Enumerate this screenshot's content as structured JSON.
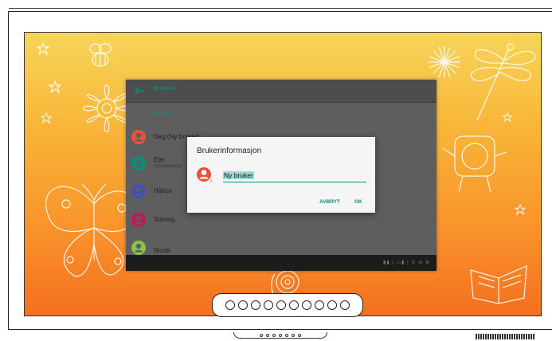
{
  "app_bar": {
    "title": "Brukere"
  },
  "section_header": "Brukere",
  "users": [
    {
      "name": "Deg (Ny bruker)",
      "subtitle": "",
      "color": "#e8523a"
    },
    {
      "name": "Eier",
      "subtitle": "Administrator",
      "color": "#0e8c7e"
    },
    {
      "name": "Håkon",
      "subtitle": "",
      "color": "#3f51b5"
    },
    {
      "name": "Solveig",
      "subtitle": "",
      "color": "#c2185b"
    },
    {
      "name": "Norsk",
      "subtitle": "",
      "color": "#8bc34a"
    }
  ],
  "dialog": {
    "title": "Brukerinformasjon",
    "name_value": "Ny bruker",
    "cancel_label": "AVBRYT",
    "ok_label": "OK",
    "avatar_color": "#e8523a"
  },
  "nav_bar": {
    "icons": "▮▮ | ▭▮ | ◎ ⊖ ⊗"
  },
  "colors": {
    "accent": "#0e8c7e",
    "screen_top": "#f7d55a",
    "screen_bottom": "#f56f1f"
  }
}
